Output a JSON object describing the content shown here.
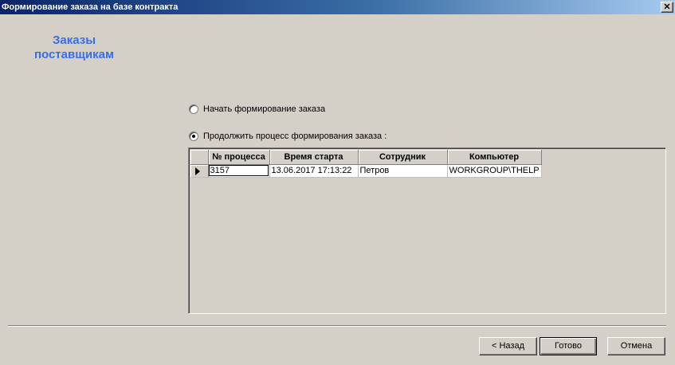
{
  "window": {
    "title": "Формирование заказа на базе контракта",
    "close_glyph": "✕"
  },
  "heading": {
    "line1": "Заказы",
    "line2": "поставщикам"
  },
  "options": {
    "start_label": "Начать формирование заказа",
    "continue_label": "Продолжить процесс формирования заказа :",
    "selected": "continue"
  },
  "grid": {
    "columns": [
      "№ процесса",
      "Время старта",
      "Сотрудник",
      "Компьютер"
    ],
    "rows": [
      [
        "3157",
        "13.06.2017 17:13:22",
        "Петров",
        "WORKGROUP\\THELP"
      ]
    ]
  },
  "buttons": {
    "back": "< Назад",
    "done": "Готово",
    "cancel": "Отмена"
  }
}
